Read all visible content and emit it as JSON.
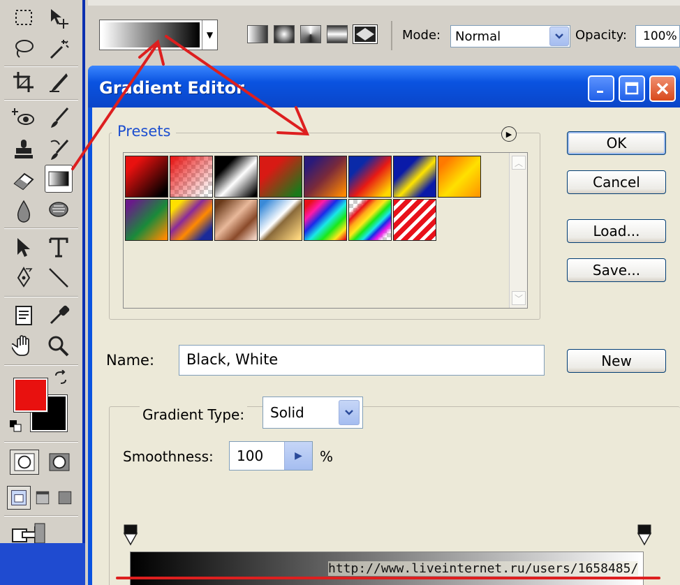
{
  "toolbox": {
    "tools": [
      "marquee-icon",
      "move-icon",
      "lasso-icon",
      "magic-wand-icon",
      "crop-icon",
      "slice-icon",
      "healing-brush-icon",
      "brush-icon",
      "clone-stamp-icon",
      "history-brush-icon",
      "eraser-icon",
      "gradient-icon",
      "blur-icon",
      "dodge-icon",
      "path-select-icon",
      "type-icon",
      "pen-icon",
      "line-icon",
      "notes-icon",
      "eyedropper-icon",
      "hand-icon",
      "zoom-icon"
    ],
    "foreground_color": "#e8110f",
    "background_color": "#000000"
  },
  "options_bar": {
    "mode_label": "Mode:",
    "mode_value": "Normal",
    "opacity_label": "Opacity:",
    "opacity_value": "100%"
  },
  "dialog": {
    "title": "Gradient Editor",
    "presets_label": "Presets",
    "buttons": {
      "ok": "OK",
      "cancel": "Cancel",
      "load": "Load...",
      "save": "Save...",
      "new": "New"
    },
    "name_label": "Name:",
    "name_value": "Black, White",
    "gradient_type_label": "Gradient Type:",
    "gradient_type_value": "Solid",
    "smoothness_label": "Smoothness:",
    "smoothness_value": "100",
    "smoothness_unit": "%"
  },
  "presets": [
    "foreground-to-background",
    "foreground-to-transparent",
    "black-white",
    "red-green",
    "violet-orange",
    "blue-red-yellow",
    "blue-yellow-blue",
    "orange-yellow-orange",
    "violet-green-orange",
    "yellow-violet-orange-blue",
    "copper",
    "chrome",
    "spectrum",
    "transparent-rainbow",
    "transparent-stripes"
  ],
  "watermark": "http://www.liveinternet.ru/users/1658485/",
  "colors": {
    "annotation": "#dd1f1f",
    "title_blue": "#0a53e0",
    "presets_label": "#1d4fcf"
  }
}
